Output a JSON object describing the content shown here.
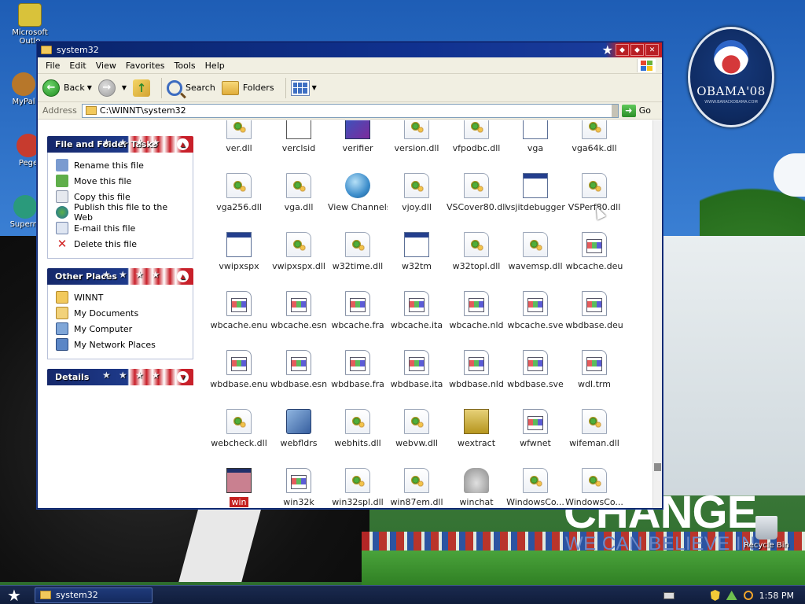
{
  "desktop": {
    "icons": [
      {
        "label": "Microsoft Outlo",
        "icon": "outlook-icon"
      },
      {
        "label": "MyPal",
        "icon": "mypal-icon"
      },
      {
        "label": "Pege",
        "icon": "pegasus-icon"
      },
      {
        "label": "Superm",
        "icon": "superman-icon"
      }
    ],
    "recycle_bin": "Recycle Bin",
    "wallpaper": {
      "logo_text": "OBAMA'08",
      "logo_url": "WWW.BARACKOBAMA.COM",
      "headline": "CHANGE",
      "subline": "WE CAN BELIEVE IN"
    }
  },
  "window": {
    "title": "system32",
    "menu": [
      "File",
      "Edit",
      "View",
      "Favorites",
      "Tools",
      "Help"
    ],
    "toolbar": {
      "back": "Back",
      "search": "Search",
      "folders": "Folders"
    },
    "address": {
      "label": "Address",
      "value": "C:\\WINNT\\system32",
      "go": "Go"
    },
    "sidebar": {
      "file_tasks": {
        "title": "File and Folder Tasks",
        "items": [
          {
            "label": "Rename this file",
            "icon": "rename-icon"
          },
          {
            "label": "Move this file",
            "icon": "move-icon"
          },
          {
            "label": "Copy this file",
            "icon": "copy-icon"
          },
          {
            "label": "Publish this file to the Web",
            "icon": "publish-web-icon"
          },
          {
            "label": "E-mail this file",
            "icon": "email-icon"
          },
          {
            "label": "Delete this file",
            "icon": "delete-icon"
          }
        ]
      },
      "other_places": {
        "title": "Other Places",
        "items": [
          {
            "label": "WINNT",
            "icon": "folder-icon"
          },
          {
            "label": "My Documents",
            "icon": "my-documents-icon"
          },
          {
            "label": "My Computer",
            "icon": "my-computer-icon"
          },
          {
            "label": "My Network Places",
            "icon": "network-places-icon"
          }
        ]
      },
      "details": {
        "title": "Details"
      }
    },
    "files": [
      [
        "ver.dll",
        "verclsid",
        "verifier",
        "version.dll",
        "vfpodbc.dll",
        "vga",
        "vga64k.dll"
      ],
      [
        "vga256.dll",
        "vga.dll",
        "View Channels",
        "vjoy.dll",
        "VSCover80.dll",
        "vsjitdebugger",
        "VSPerf80.dll"
      ],
      [
        "vwipxspx",
        "vwipxspx.dll",
        "w32time.dll",
        "w32tm",
        "w32topl.dll",
        "wavemsp.dll",
        "wbcache.deu"
      ],
      [
        "wbcache.enu",
        "wbcache.esn",
        "wbcache.fra",
        "wbcache.ita",
        "wbcache.nld",
        "wbcache.sve",
        "wbdbase.deu"
      ],
      [
        "wbdbase.enu",
        "wbdbase.esn",
        "wbdbase.fra",
        "wbdbase.ita",
        "wbdbase.nld",
        "wbdbase.sve",
        "wdl.trm"
      ],
      [
        "webcheck.dll",
        "webfldrs",
        "webhits.dll",
        "webvw.dll",
        "wextract",
        "wfwnet",
        "wifeman.dll"
      ],
      [
        "win",
        "win32k",
        "win32spl.dll",
        "win87em.dll",
        "winchat",
        "WindowsCo...",
        "WindowsCo..."
      ]
    ],
    "selected_file": "win"
  },
  "taskbar": {
    "task": "system32",
    "clock": "1:58 PM"
  }
}
